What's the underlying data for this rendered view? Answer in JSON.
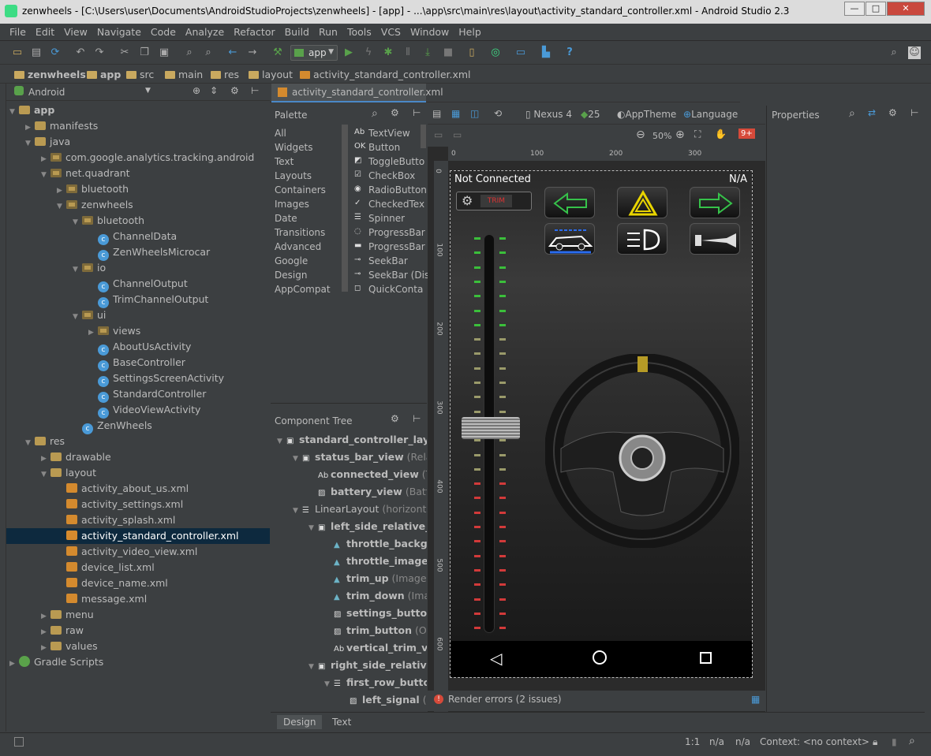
{
  "window": {
    "title": "zenwheels - [C:\\Users\\user\\Documents\\AndroidStudioProjects\\zenwheels] - [app] - ...\\app\\src\\main\\res\\layout\\activity_standard_controller.xml - Android Studio 2.3",
    "min": "—",
    "max": "□",
    "close": "✕"
  },
  "menu": [
    "File",
    "Edit",
    "View",
    "Navigate",
    "Code",
    "Analyze",
    "Refactor",
    "Build",
    "Run",
    "Tools",
    "VCS",
    "Window",
    "Help"
  ],
  "toolbar": {
    "run_config": "app"
  },
  "breadcrumbs": [
    "zenwheels",
    "app",
    "src",
    "main",
    "res",
    "layout",
    "activity_standard_controller.xml"
  ],
  "project": {
    "view": "Android",
    "items": [
      {
        "label": "app",
        "depth": 0,
        "tri": "▼",
        "icon": "folder",
        "bold": true
      },
      {
        "label": "manifests",
        "depth": 1,
        "tri": "▶",
        "icon": "folder"
      },
      {
        "label": "java",
        "depth": 1,
        "tri": "▼",
        "icon": "folder"
      },
      {
        "label": "com.google.analytics.tracking.android",
        "depth": 2,
        "tri": "▶",
        "icon": "pkg"
      },
      {
        "label": "net.quadrant",
        "depth": 2,
        "tri": "▼",
        "icon": "pkg"
      },
      {
        "label": "bluetooth",
        "depth": 3,
        "tri": "▶",
        "icon": "pkg"
      },
      {
        "label": "zenwheels",
        "depth": 3,
        "tri": "▼",
        "icon": "pkg"
      },
      {
        "label": "bluetooth",
        "depth": 4,
        "tri": "▼",
        "icon": "pkg"
      },
      {
        "label": "ChannelData",
        "depth": 5,
        "tri": "",
        "icon": "cls"
      },
      {
        "label": "ZenWheelsMicrocar",
        "depth": 5,
        "tri": "",
        "icon": "cls"
      },
      {
        "label": "io",
        "depth": 4,
        "tri": "▼",
        "icon": "pkg"
      },
      {
        "label": "ChannelOutput",
        "depth": 5,
        "tri": "",
        "icon": "cls"
      },
      {
        "label": "TrimChannelOutput",
        "depth": 5,
        "tri": "",
        "icon": "cls"
      },
      {
        "label": "ui",
        "depth": 4,
        "tri": "▼",
        "icon": "pkg"
      },
      {
        "label": "views",
        "depth": 5,
        "tri": "▶",
        "icon": "pkg"
      },
      {
        "label": "AboutUsActivity",
        "depth": 5,
        "tri": "",
        "icon": "cls"
      },
      {
        "label": "BaseController",
        "depth": 5,
        "tri": "",
        "icon": "cls"
      },
      {
        "label": "SettingsScreenActivity",
        "depth": 5,
        "tri": "",
        "icon": "cls"
      },
      {
        "label": "StandardController",
        "depth": 5,
        "tri": "",
        "icon": "cls"
      },
      {
        "label": "VideoViewActivity",
        "depth": 5,
        "tri": "",
        "icon": "cls"
      },
      {
        "label": "ZenWheels",
        "depth": 4,
        "tri": "",
        "icon": "cls"
      },
      {
        "label": "res",
        "depth": 1,
        "tri": "▼",
        "icon": "folder"
      },
      {
        "label": "drawable",
        "depth": 2,
        "tri": "▶",
        "icon": "folder"
      },
      {
        "label": "layout",
        "depth": 2,
        "tri": "▼",
        "icon": "folder"
      },
      {
        "label": "activity_about_us.xml",
        "depth": 3,
        "tri": "",
        "icon": "xml"
      },
      {
        "label": "activity_settings.xml",
        "depth": 3,
        "tri": "",
        "icon": "xml"
      },
      {
        "label": "activity_splash.xml",
        "depth": 3,
        "tri": "",
        "icon": "xml"
      },
      {
        "label": "activity_standard_controller.xml",
        "depth": 3,
        "tri": "",
        "icon": "xml",
        "selected": true
      },
      {
        "label": "activity_video_view.xml",
        "depth": 3,
        "tri": "",
        "icon": "xml"
      },
      {
        "label": "device_list.xml",
        "depth": 3,
        "tri": "",
        "icon": "xml"
      },
      {
        "label": "device_name.xml",
        "depth": 3,
        "tri": "",
        "icon": "xml"
      },
      {
        "label": "message.xml",
        "depth": 3,
        "tri": "",
        "icon": "xml"
      },
      {
        "label": "menu",
        "depth": 2,
        "tri": "▶",
        "icon": "folder"
      },
      {
        "label": "raw",
        "depth": 2,
        "tri": "▶",
        "icon": "folder"
      },
      {
        "label": "values",
        "depth": 2,
        "tri": "▶",
        "icon": "folder"
      },
      {
        "label": "Gradle Scripts",
        "depth": 0,
        "tri": "▶",
        "icon": "grad"
      }
    ]
  },
  "editor_tab": "activity_standard_controller.xml",
  "palette": {
    "title": "Palette",
    "categories": [
      "All",
      "Widgets",
      "Text",
      "Layouts",
      "Containers",
      "Images",
      "Date",
      "Transitions",
      "Advanced",
      "Google",
      "Design",
      "AppCompat"
    ],
    "widgets": [
      "TextView",
      "Button",
      "ToggleButto",
      "CheckBox",
      "RadioButton",
      "CheckedTex",
      "Spinner",
      "ProgressBar",
      "ProgressBar",
      "SeekBar",
      "SeekBar (Dis",
      "QuickConta"
    ],
    "widget_icons": [
      "Ab",
      "OK",
      "◩",
      "☑",
      "◉",
      "✓",
      "☰",
      "◌",
      "▬",
      "⊸",
      "⊸",
      "◻"
    ]
  },
  "component_tree": {
    "title": "Component Tree",
    "items": [
      {
        "label": "standard_controller_layout",
        "hint": "",
        "depth": 0,
        "tri": "▼",
        "icon": "▣"
      },
      {
        "label": "status_bar_view",
        "hint": " (Relative",
        "depth": 1,
        "tri": "▼",
        "icon": "▣"
      },
      {
        "label": "connected_view",
        "hint": " (Te",
        "depth": 2,
        "tri": "",
        "icon": "Ab"
      },
      {
        "label": "battery_view",
        "hint": " (Batter",
        "depth": 2,
        "tri": "",
        "icon": "▨"
      },
      {
        "label": "LinearLayout",
        "hint": " (horizontal)",
        "depth": 1,
        "tri": "▼",
        "icon": "☰",
        "plain": true
      },
      {
        "label": "left_side_relative_lay",
        "hint": "",
        "depth": 2,
        "tri": "▼",
        "icon": "▣"
      },
      {
        "label": "throttle_backgro",
        "hint": "",
        "depth": 3,
        "tri": "",
        "icon": "▲"
      },
      {
        "label": "throttle_image",
        "hint": " (I",
        "depth": 3,
        "tri": "",
        "icon": "▲"
      },
      {
        "label": "trim_up",
        "hint": " (ImageBu",
        "depth": 3,
        "tri": "",
        "icon": "▲"
      },
      {
        "label": "trim_down",
        "hint": " (Imag",
        "depth": 3,
        "tri": "",
        "icon": "▲"
      },
      {
        "label": "settings_button",
        "hint": " (",
        "depth": 3,
        "tri": "",
        "icon": "▨"
      },
      {
        "label": "trim_button",
        "hint": " (On",
        "depth": 3,
        "tri": "",
        "icon": "▨"
      },
      {
        "label": "vertical_trim_val",
        "hint": "",
        "depth": 3,
        "tri": "",
        "icon": "Ab"
      },
      {
        "label": "right_side_relative_la",
        "hint": "",
        "depth": 2,
        "tri": "▼",
        "icon": "▣"
      },
      {
        "label": "first_row_button",
        "hint": "",
        "depth": 3,
        "tri": "▼",
        "icon": "☰"
      },
      {
        "label": "left_signal",
        "hint": " (O",
        "depth": 4,
        "tri": "",
        "icon": "▨"
      }
    ]
  },
  "design_toolbar": {
    "device": "Nexus 4",
    "api": "25",
    "theme": "AppTheme",
    "language": "Language",
    "zoom": "50%",
    "badge": "9+"
  },
  "ruler": {
    "h": [
      "0",
      "100",
      "200",
      "300"
    ],
    "v": [
      "0",
      "100",
      "200",
      "300",
      "400",
      "500",
      "600"
    ]
  },
  "phone": {
    "status_left": "Not Connected",
    "status_right": "N/A",
    "trim": "TRIM"
  },
  "render_errors": "Render errors (2 issues)",
  "properties": {
    "title": "Properties"
  },
  "bottom_tabs": [
    "Design",
    "Text"
  ],
  "status": {
    "pos": "1:1",
    "a": "n/a",
    "b": "n/a",
    "context": "Context: <no context>"
  }
}
